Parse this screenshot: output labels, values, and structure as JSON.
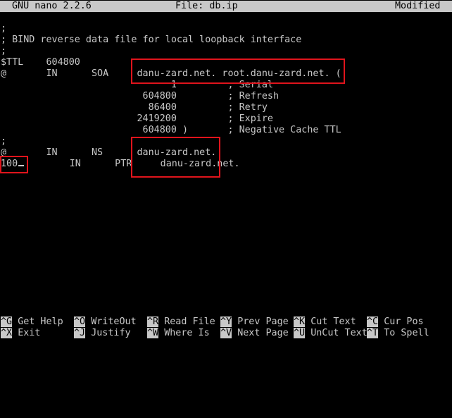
{
  "titlebar": {
    "app": "GNU nano 2.2.6",
    "file": "File: db.ip",
    "status": "Modified"
  },
  "lines": [
    ";",
    "; BIND reverse data file for local loopback interface",
    ";",
    "$TTL    604800",
    "@       IN      SOA     danu-zard.net. root.danu-zard.net. (",
    "                              1         ; Serial",
    "                         604800         ; Refresh",
    "                          86400         ; Retry",
    "                        2419200         ; Expire",
    "                         604800 )       ; Negative Cache TTL",
    ";",
    "@       IN      NS      danu-zard.net.",
    "100",
    "        IN      PTR     danu-zard.net."
  ],
  "shortcuts": {
    "row1": [
      {
        "key": "^G",
        "label": "Get Help"
      },
      {
        "key": "^O",
        "label": "WriteOut"
      },
      {
        "key": "^R",
        "label": "Read File"
      },
      {
        "key": "^Y",
        "label": "Prev Page"
      },
      {
        "key": "^K",
        "label": "Cut Text"
      },
      {
        "key": "^C",
        "label": "Cur Pos"
      }
    ],
    "row2": [
      {
        "key": "^X",
        "label": "Exit"
      },
      {
        "key": "^J",
        "label": "Justify"
      },
      {
        "key": "^W",
        "label": "Where Is"
      },
      {
        "key": "^V",
        "label": "Next Page"
      },
      {
        "key": "^U",
        "label": "UnCut Text"
      },
      {
        "key": "^T",
        "label": "To Spell"
      }
    ]
  },
  "colors": {
    "highlight": "#e0141c",
    "text": "#c8c8c8",
    "background": "#000000"
  }
}
